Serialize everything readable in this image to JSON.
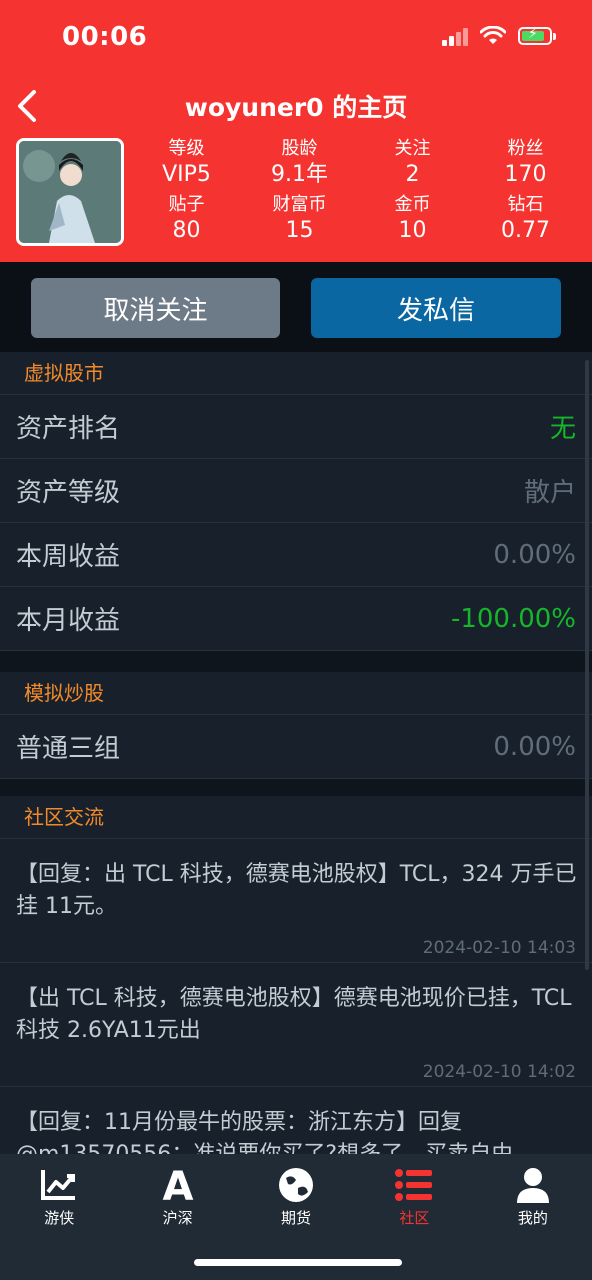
{
  "status_bar": {
    "time": "00:06"
  },
  "header": {
    "title": "woyuner0 的主页",
    "stats": [
      {
        "label": "等级",
        "value": "VIP5"
      },
      {
        "label": "股龄",
        "value": "9.1年"
      },
      {
        "label": "关注",
        "value": "2"
      },
      {
        "label": "粉丝",
        "value": "170"
      },
      {
        "label": "贴子",
        "value": "80"
      },
      {
        "label": "财富币",
        "value": "15"
      },
      {
        "label": "金币",
        "value": "10"
      },
      {
        "label": "钻石",
        "value": "0.77"
      }
    ]
  },
  "actions": {
    "unfollow_label": "取消关注",
    "message_label": "发私信"
  },
  "virtual_market": {
    "title": "虚拟股市",
    "rows": [
      {
        "label": "资产排名",
        "value": "无"
      },
      {
        "label": "资产等级",
        "value": "散户"
      },
      {
        "label": "本周收益",
        "value": "0.00%"
      },
      {
        "label": "本月收益",
        "value": "-100.00%"
      }
    ]
  },
  "simulated_trading": {
    "title": "模拟炒股",
    "rows": [
      {
        "label": "普通三组",
        "value": "0.00%"
      }
    ]
  },
  "community": {
    "title": "社区交流",
    "posts": [
      {
        "text": "【回复：出 TCL 科技，德赛电池股权】TCL，324 万手已挂 11元。",
        "time": "2024-02-10 14:03"
      },
      {
        "text": "【出 TCL 科技，德赛电池股权】德赛电池现价已挂，TCL 科技 2.6YA11元出",
        "time": "2024-02-10 14:02"
      },
      {
        "text": "【回复：11月份最牛的股票：浙江东方】回复@m13570556：准说要你买了?想多了，买卖自由",
        "time": ""
      }
    ]
  },
  "tabbar": {
    "tabs": [
      {
        "label": "游侠",
        "icon": "chart-icon"
      },
      {
        "label": "沪深",
        "icon": "letter-a-icon"
      },
      {
        "label": "期货",
        "icon": "globe-icon"
      },
      {
        "label": "社区",
        "icon": "list-icon"
      },
      {
        "label": "我的",
        "icon": "user-icon"
      }
    ],
    "active": "社区"
  },
  "colors": {
    "brand_red": "#f53432",
    "accent_orange": "#f28a2a",
    "positive_green": "#15b62a",
    "message_blue": "#0a67a2"
  }
}
